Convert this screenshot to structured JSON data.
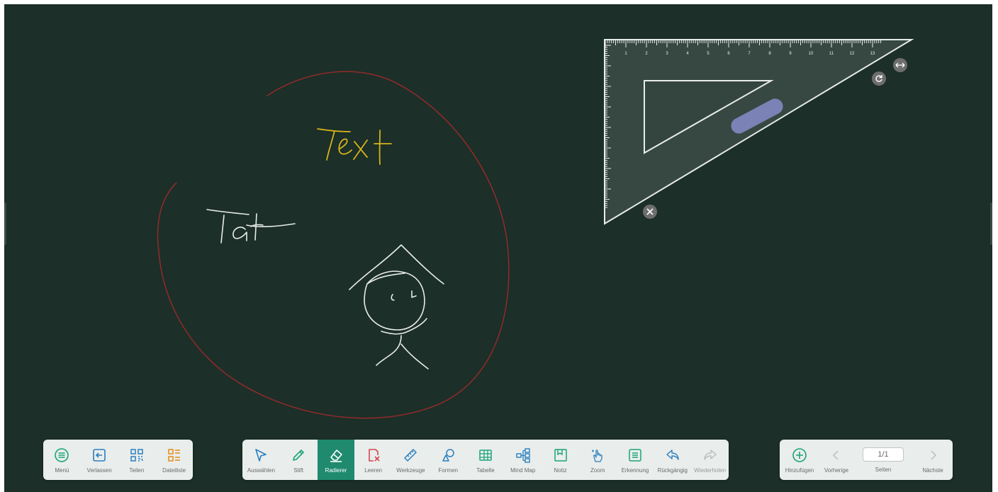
{
  "canvas": {
    "background_color": "#1c2f28",
    "handwriting": {
      "yellow_word": "Text",
      "white_word": "Tat"
    },
    "colors": {
      "red_stroke": "#8b2b2b",
      "yellow_ink": "#d6b21d",
      "white_ink": "#e8ece9"
    }
  },
  "set_square": {
    "ruler_numbers": [
      "1",
      "2",
      "3",
      "4",
      "5",
      "6",
      "7",
      "8",
      "9",
      "10",
      "11",
      "12",
      "13"
    ],
    "close_icon": "close-icon",
    "rotate_icon": "rotate-icon",
    "resize_icon": "resize-horizontal-icon",
    "handle_color": "#7b82b6"
  },
  "toolbar_left": {
    "items": [
      {
        "label": "Menü",
        "icon": "menu-icon"
      },
      {
        "label": "Verlassen",
        "icon": "exit-icon"
      },
      {
        "label": "Teilen",
        "icon": "qr-share-icon"
      },
      {
        "label": "Dateiliste",
        "icon": "file-list-icon"
      }
    ]
  },
  "toolbar_center": {
    "items": [
      {
        "label": "Auswählen",
        "icon": "select-cursor-icon"
      },
      {
        "label": "Stift",
        "icon": "pen-icon"
      },
      {
        "label": "Radierer",
        "icon": "eraser-icon",
        "active": true
      },
      {
        "label": "Leeren",
        "icon": "clear-icon"
      },
      {
        "label": "Werkzeuge",
        "icon": "ruler-tools-icon"
      },
      {
        "label": "Formen",
        "icon": "shapes-icon"
      },
      {
        "label": "Tabelle",
        "icon": "table-icon"
      },
      {
        "label": "Mind Map",
        "icon": "mind-map-icon"
      },
      {
        "label": "Notiz",
        "icon": "note-icon"
      },
      {
        "label": "Zoom",
        "icon": "zoom-hand-icon"
      },
      {
        "label": "Erkennung",
        "icon": "recognition-icon"
      },
      {
        "label": "Rückgängig",
        "icon": "undo-icon"
      },
      {
        "label": "Wiederholen",
        "icon": "redo-icon",
        "disabled": true
      }
    ],
    "active_color": "#1f8a6e"
  },
  "toolbar_right": {
    "add_label": "Hinzufügen",
    "prev_label": "Vorherige",
    "page_value": "1/1",
    "pages_label": "Seiten",
    "next_label": "Nächste"
  }
}
